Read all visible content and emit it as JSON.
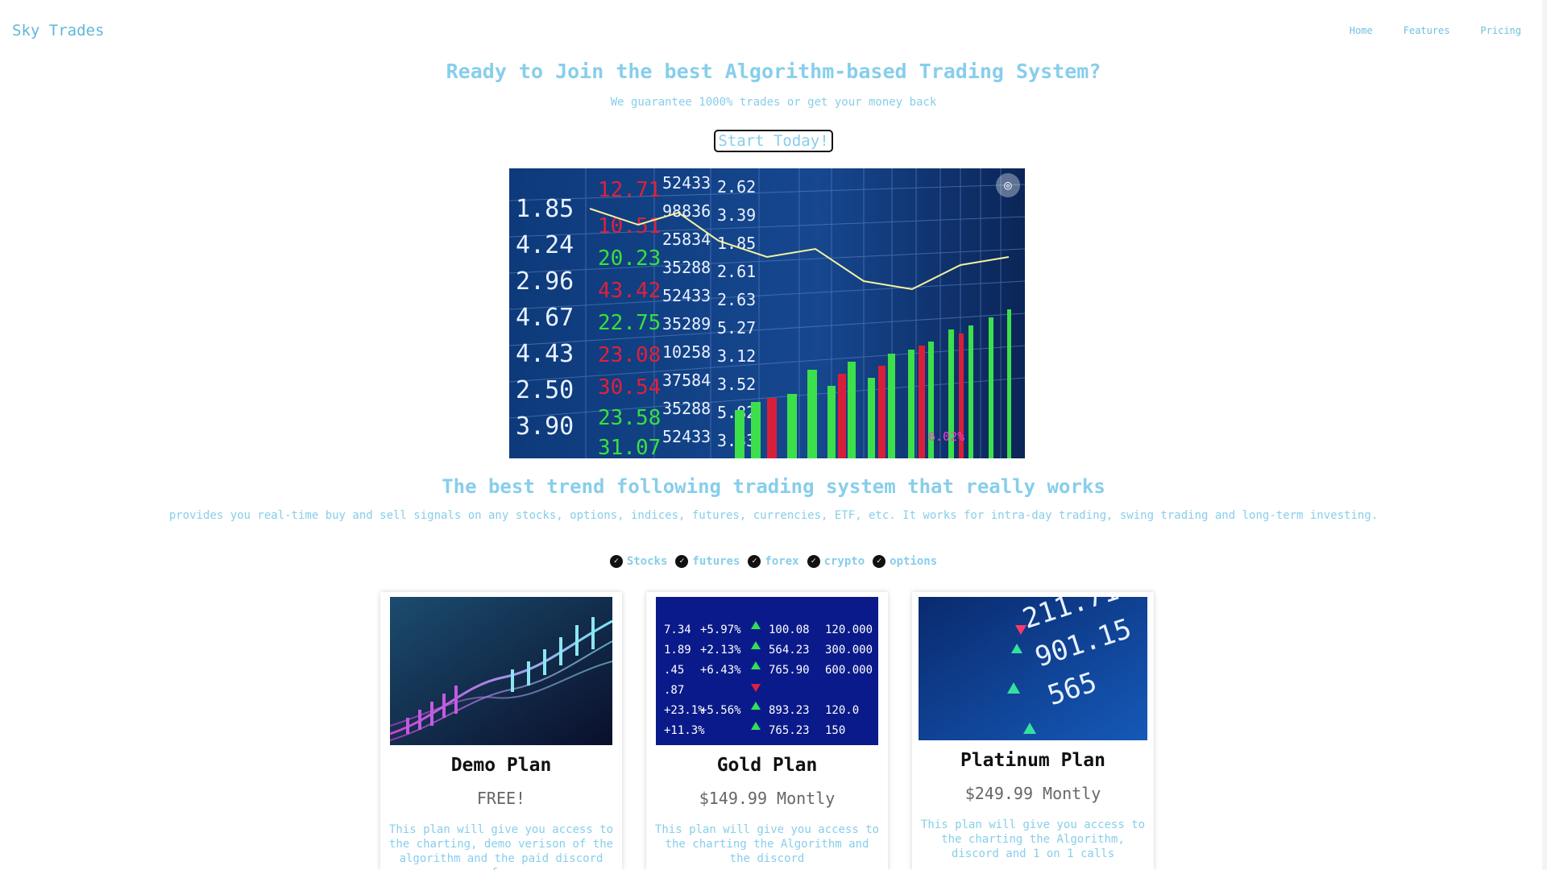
{
  "nav": {
    "brand": "Sky Trades",
    "links": [
      "Home",
      "Features",
      "Pricing"
    ]
  },
  "hero": {
    "headline": "Ready to Join the best Algorithm-based Trading System?",
    "subline": "We guarantee 1000% trades or get your money back",
    "cta": "Start Today!",
    "image_label": "6.02%"
  },
  "section": {
    "title": "The best trend following trading system that really works",
    "description": "provides you real-time buy and sell signals on any stocks, options, indices, futures, currencies, ETF, etc. It works for intra-day trading, swing trading and long-term investing."
  },
  "markets": [
    "Stocks",
    "futures",
    "forex",
    "crypto",
    "options"
  ],
  "plans": [
    {
      "name": "Demo Plan",
      "price": "FREE!",
      "description": "This plan will give you access to the charting, demo verison of the algorithm and the paid discord for"
    },
    {
      "name": "Gold Plan",
      "price": "$149.99 Montly",
      "description": "This plan will give you access to the charting the Algorithm and the discord"
    },
    {
      "name": "Platinum Plan",
      "price": "$249.99 Montly",
      "description": "This plan will give you access to the charting the Algorithm, discord and 1 on 1 calls"
    }
  ],
  "colors": {
    "accent": "#87ceeb",
    "heading": "#111111",
    "price": "#666666"
  }
}
